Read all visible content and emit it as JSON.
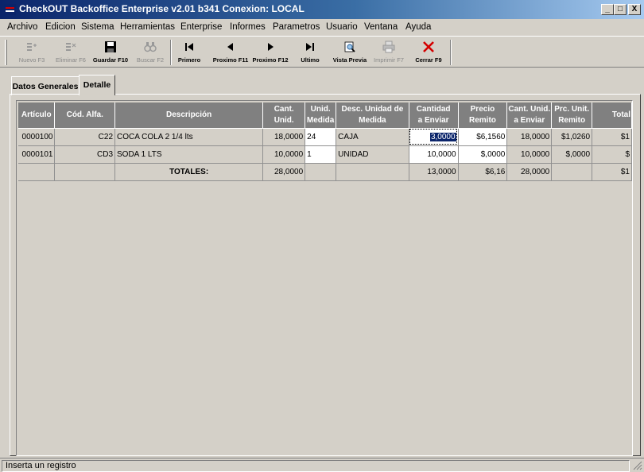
{
  "window": {
    "title": "CheckOUT Backoffice Enterprise v2.01 b341 Conexion: LOCAL",
    "controls": {
      "minimize": "_",
      "maximize": "□",
      "close": "X"
    }
  },
  "menu": [
    "Archivo",
    "Edicion",
    "Sistema",
    "Herramientas",
    "Enterprise",
    "Informes",
    "Parametros",
    "Usuario",
    "Ventana",
    "Ayuda"
  ],
  "toolbar": [
    {
      "label": "Nuevo F3",
      "icon": "new-record-icon",
      "enabled": false
    },
    {
      "label": "Eliminar F6",
      "icon": "delete-record-icon",
      "enabled": false
    },
    {
      "label": "Guardar F10",
      "icon": "floppy-save-icon",
      "enabled": true
    },
    {
      "label": "Buscar F2",
      "icon": "binoculars-icon",
      "enabled": false
    },
    {
      "label": "Primero",
      "icon": "first-record-icon",
      "enabled": true
    },
    {
      "label": "Proximo F11",
      "icon": "previous-arrow-icon",
      "enabled": true
    },
    {
      "label": "Proximo F12",
      "icon": "next-arrow-icon",
      "enabled": true
    },
    {
      "label": "Ultimo",
      "icon": "last-record-icon",
      "enabled": true
    },
    {
      "label": "Vista Previa",
      "icon": "print-preview-icon",
      "enabled": true
    },
    {
      "label": "Imprimir F7",
      "icon": "printer-icon",
      "enabled": false
    },
    {
      "label": "Cerrar F9",
      "icon": "close-x-icon",
      "enabled": true
    }
  ],
  "tabs": [
    {
      "label": "Datos Generales",
      "active": false
    },
    {
      "label": "Detalle",
      "active": true
    }
  ],
  "grid": {
    "headers": [
      [
        "Artículo"
      ],
      [
        "Cód. Alfa."
      ],
      [
        "Descripción"
      ],
      [
        "Cant.",
        "Unid."
      ],
      [
        "Unid.",
        "Medida"
      ],
      [
        "Desc. Unidad de",
        "Medida"
      ],
      [
        "Cantidad",
        "a Enviar"
      ],
      [
        "Precio",
        "Remito"
      ],
      [
        "Cant. Unid.",
        "a Enviar"
      ],
      [
        "Prc. Unit.",
        "Remito"
      ],
      [
        "Total"
      ]
    ],
    "rows": [
      [
        "0000100",
        "C22",
        "COCA COLA 2 1/4 lts",
        "18,0000",
        "24",
        "CAJA",
        "3,0000",
        "$6,1560",
        "18,0000",
        "$1,0260",
        "$1"
      ],
      [
        "0000101",
        "CD3",
        "SODA 1 LTS",
        "10,0000",
        "1",
        "UNIDAD",
        "10,0000",
        "$,0000",
        "10,0000",
        "$,0000",
        "$"
      ]
    ],
    "totals": {
      "label": "TOTALES:",
      "cant_unid": "28,0000",
      "cantidad_enviar": "13,0000",
      "precio_remito": "$6,16",
      "cant_unid_enviar": "28,0000",
      "total": "$1"
    }
  },
  "status": {
    "text": "Inserta un registro"
  },
  "colors": {
    "title_start": "#0a246a",
    "title_end": "#a6caf0",
    "window_bg": "#d4d0c8",
    "header_bg": "#808080",
    "close_red": "#d40000"
  }
}
